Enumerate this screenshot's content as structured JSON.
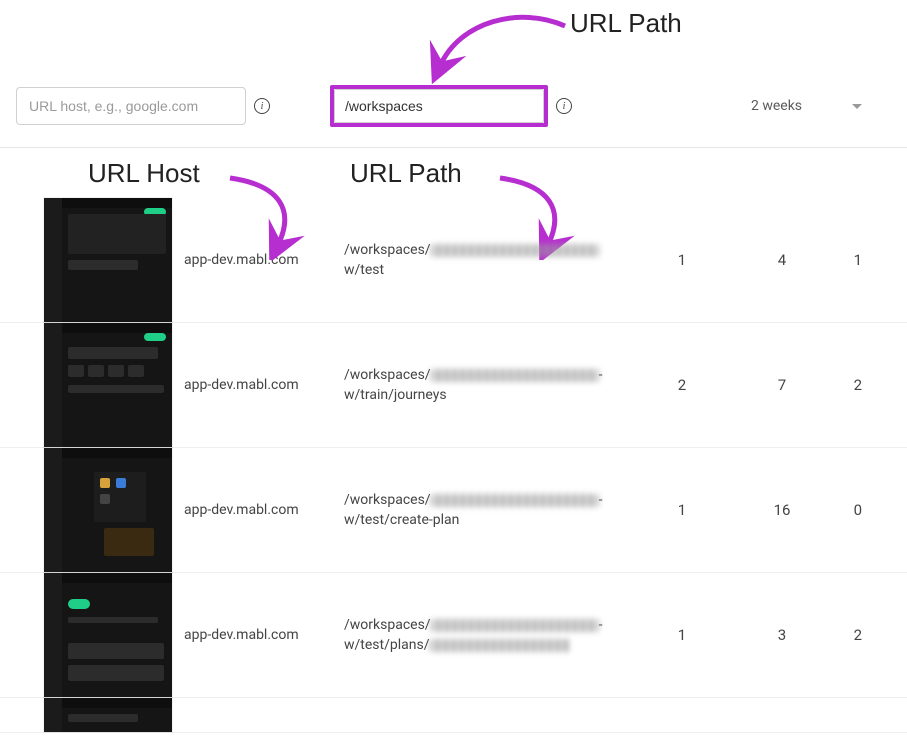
{
  "filters": {
    "host_placeholder": "URL host, e.g., google.com",
    "path_value": "/workspaces",
    "timerange_label": "2 weeks"
  },
  "annotations": {
    "top_label": "URL Path",
    "host_label": "URL Host",
    "path_label": "URL Path"
  },
  "rows": [
    {
      "host": "app-dev.mabl.com",
      "path_prefix": "/workspaces/",
      "path_suffix": "w/test",
      "col1": "1",
      "col2": "4",
      "col3": "1"
    },
    {
      "host": "app-dev.mabl.com",
      "path_prefix": "/workspaces/",
      "path_suffix": "w/train/journeys",
      "col1": "2",
      "col2": "7",
      "col3": "2"
    },
    {
      "host": "app-dev.mabl.com",
      "path_prefix": "/workspaces/",
      "path_suffix": "w/test/create-plan",
      "col1": "1",
      "col2": "16",
      "col3": "0"
    },
    {
      "host": "app-dev.mabl.com",
      "path_prefix": "/workspaces/",
      "path_suffix": "w/test/plans/",
      "has_trailing_redact": true,
      "col1": "1",
      "col2": "3",
      "col3": "2"
    }
  ],
  "colors": {
    "highlight": "#b72ed0"
  }
}
